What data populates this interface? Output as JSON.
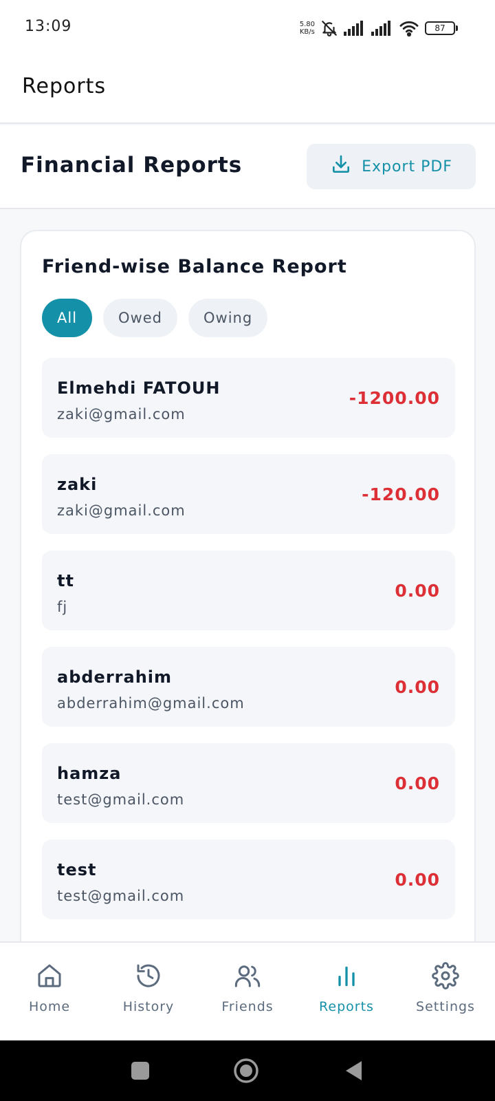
{
  "status_bar": {
    "time": "13:09",
    "net_speed_value": "5.80",
    "net_speed_unit": "KB/s",
    "battery": "87",
    "icons": [
      "muted-bell-icon",
      "signal-icon",
      "signal-icon",
      "wifi-icon",
      "battery-icon"
    ]
  },
  "app_bar": {
    "title": "Reports"
  },
  "header": {
    "title": "Financial Reports",
    "export_label": "Export PDF",
    "export_icon": "download-icon"
  },
  "report": {
    "title": "Friend-wise Balance Report",
    "filters": [
      {
        "label": "All",
        "active": true
      },
      {
        "label": "Owed",
        "active": false
      },
      {
        "label": "Owing",
        "active": false
      }
    ],
    "rows": [
      {
        "name": "Elmehdi FATOUH",
        "email": "zaki@gmail.com",
        "amount": "-1200.00"
      },
      {
        "name": "zaki",
        "email": "zaki@gmail.com",
        "amount": "-120.00"
      },
      {
        "name": "tt",
        "email": "fj",
        "amount": "0.00"
      },
      {
        "name": "abderrahim",
        "email": "abderrahim@gmail.com",
        "amount": "0.00"
      },
      {
        "name": "hamza",
        "email": "test@gmail.com",
        "amount": "0.00"
      },
      {
        "name": "test",
        "email": "test@gmail.com",
        "amount": "0.00"
      }
    ]
  },
  "bottom_nav": {
    "items": [
      {
        "label": "Home",
        "icon": "home-icon",
        "active": false
      },
      {
        "label": "History",
        "icon": "history-icon",
        "active": false
      },
      {
        "label": "Friends",
        "icon": "friends-icon",
        "active": false
      },
      {
        "label": "Reports",
        "icon": "bar-chart-icon",
        "active": true
      },
      {
        "label": "Settings",
        "icon": "gear-icon",
        "active": false
      }
    ]
  },
  "colors": {
    "accent": "#1491a8",
    "negative": "#dc2f36",
    "card_bg": "#f4f6f9"
  }
}
